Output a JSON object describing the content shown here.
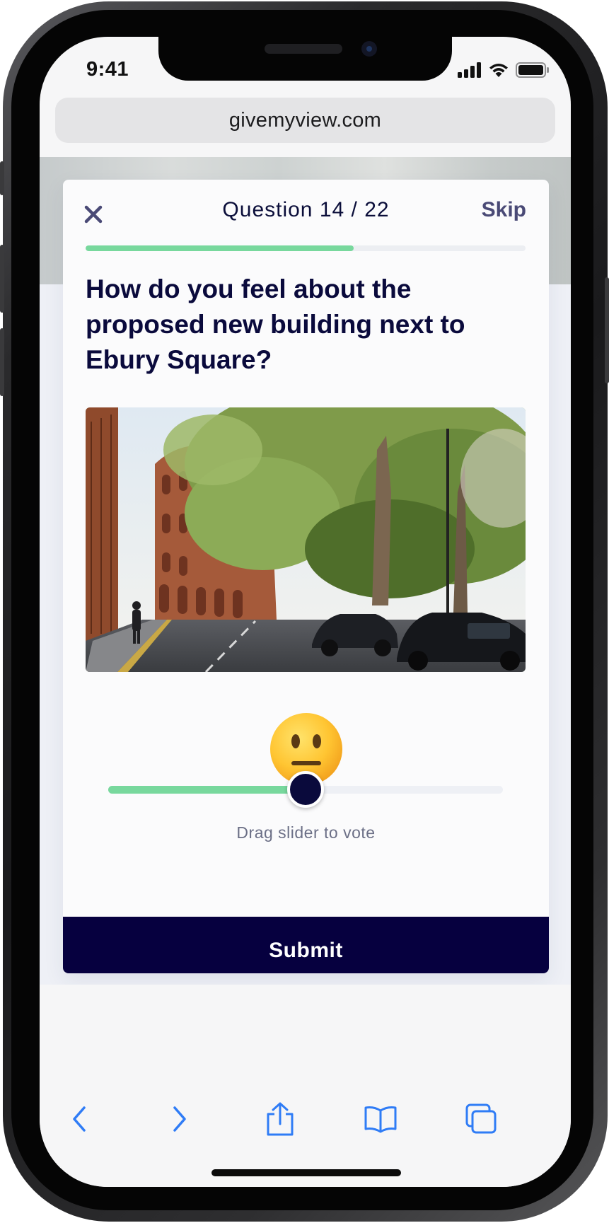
{
  "status_bar": {
    "time": "9:41",
    "icons": [
      "cellular-signal-icon",
      "wifi-icon",
      "battery-icon"
    ]
  },
  "browser": {
    "url": "givemyview.com",
    "toolbar": [
      "back-arrow-icon",
      "forward-arrow-icon",
      "share-icon",
      "bookmarks-icon",
      "tabs-icon"
    ],
    "accent_color": "#2f7cf6"
  },
  "survey": {
    "question_counter": "Question 14 / 22",
    "skip_label": "Skip",
    "progress": 0.61,
    "question": "How do you feel about the proposed new building next to Ebury Square?",
    "photo_icon": "street-photo-icon",
    "mood_icon": "neutral-face-emoji-icon",
    "slider_value": 0.5,
    "slider_hint": "Drag slider to vote",
    "submit_label": "Submit"
  },
  "colors": {
    "navy": "#0a0a3c",
    "submit_bg": "#06003f",
    "green": "#78d89d",
    "skip": "#4a4a76"
  }
}
